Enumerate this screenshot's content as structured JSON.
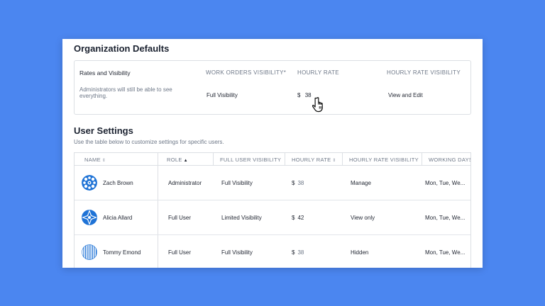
{
  "org": {
    "title": "Organization Defaults",
    "section_label": "Rates and Visibility",
    "description": "Administrators will still be able to see everything.",
    "headers": {
      "work_orders_visibility": "WORK ORDERS VISIBILITY*",
      "hourly_rate": "HOURLY RATE",
      "hourly_rate_visibility": "HOURLY RATE VISIBILITY"
    },
    "values": {
      "work_orders_visibility": "Full Visibility",
      "currency": "$",
      "hourly_rate": "38",
      "hourly_rate_visibility": "View and Edit"
    }
  },
  "users": {
    "title": "User Settings",
    "subtitle": "Use the table below to customize settings for specific users.",
    "columns": [
      "NAME",
      "ROLE",
      "FULL USER VISIBILITY",
      "HOURLY RATE",
      "HOURLY RATE VISIBILITY",
      "WORKING DAYS"
    ],
    "rows": [
      {
        "name": "Zach Brown",
        "role": "Administrator",
        "visibility": "Full Visibility",
        "currency": "$",
        "rate": "38",
        "rate_visibility": "Manage",
        "working_days": "Mon, Tue, We..."
      },
      {
        "name": "Alicia Allard",
        "role": "Full User",
        "visibility": "Limited Visibility",
        "currency": "$",
        "rate": "42",
        "rate_visibility": "View only",
        "working_days": "Mon, Tue, We..."
      },
      {
        "name": "Tommy Emond",
        "role": "Full User",
        "visibility": "Full Visibility",
        "currency": "$",
        "rate": "38",
        "rate_visibility": "Hidden",
        "working_days": "Mon, Tue, We..."
      }
    ]
  },
  "colors": {
    "background": "#4b86f0",
    "avatar_blue": "#1f73d6"
  }
}
